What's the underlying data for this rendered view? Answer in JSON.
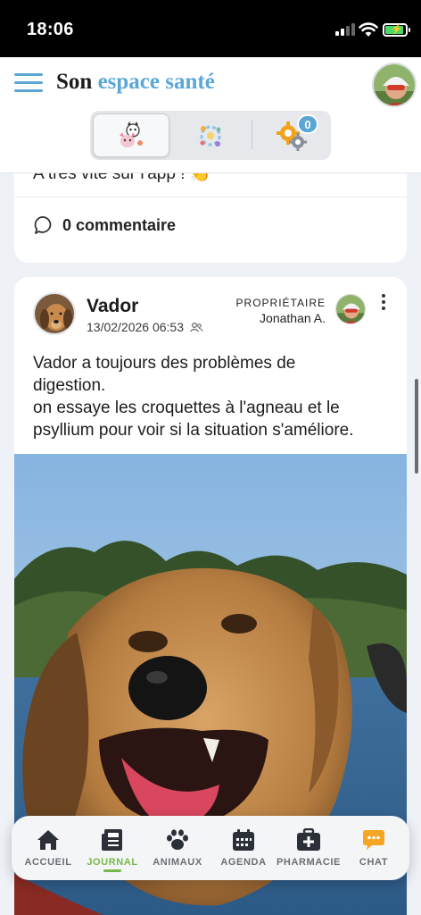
{
  "status_bar": {
    "time": "18:06"
  },
  "header": {
    "title_part1": "Son",
    "title_part2": "espace santé",
    "tabs": [
      {
        "name": "animals-journal",
        "icon": "cat-dog-icon"
      },
      {
        "name": "notifications",
        "icon": "sparkle-badge-icon",
        "badge": "0"
      },
      {
        "name": "settings",
        "icon": "gears-icon"
      }
    ]
  },
  "previous_post": {
    "text": "A très vite sur l'app ! 👏",
    "comments": "0 commentaire"
  },
  "post": {
    "pet_name": "Vador",
    "date": "13/02/2026 06:53",
    "owner_role": "PROPRIÉTAIRE",
    "owner_name": "Jonathan A.",
    "text_lines": [
      "Vador a toujours des problèmes de",
      "digestion.",
      "on essaye les croquettes à l'agneau et le",
      "psyllium pour voir si la situation s'améliore."
    ]
  },
  "tabbar": {
    "items": [
      {
        "label": "ACCUEIL",
        "icon": "home-icon"
      },
      {
        "label": "JOURNAL",
        "icon": "newspaper-icon",
        "active": true
      },
      {
        "label": "ANIMAUX",
        "icon": "paw-icon"
      },
      {
        "label": "AGENDA",
        "icon": "calendar-icon"
      },
      {
        "label": "PHARMACIE",
        "icon": "medkit-icon"
      },
      {
        "label": "CHAT",
        "icon": "chat-bubble-icon"
      }
    ]
  },
  "colors": {
    "brand_blue": "#5aa7d6",
    "active_green": "#74b84a",
    "chat_orange": "#f5a623"
  }
}
